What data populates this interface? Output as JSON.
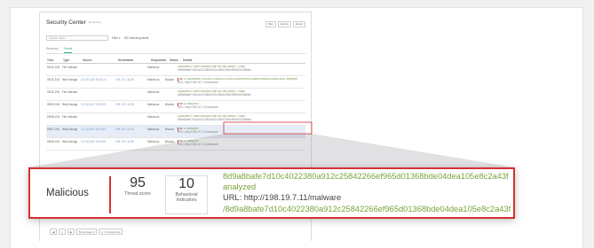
{
  "app": {
    "title": "Security Center",
    "title_suffix": "(for devices)",
    "header_buttons": [
      {
        "label": "Filter"
      },
      {
        "label": "Dismiss"
      },
      {
        "label": "Export"
      }
    ],
    "search_placeholder": "Search alerts",
    "filter_label": "Filter ▾",
    "filter_value": "150 matching alerts",
    "tabs": [
      {
        "label": "Summary"
      },
      {
        "label": "Events"
      }
    ],
    "columns": [
      "Time",
      "Type",
      "Source",
      "Destination",
      "Disposition",
      "Status",
      "Details"
    ],
    "rows": [
      {
        "time": "09:12 2/16/21",
        "type": "File Indicators 5 Support",
        "source": "",
        "destination": "",
        "disposition": "Malicious",
        "status": "",
        "detail_green": "Disposition: Hash indicator with file disk action 1 Hash",
        "detail_gray": "8d9a8bafe7d10c4022380a912c25842266ef965d01368bde"
      },
      {
        "time": "09:11 2/16/21",
        "type": "Web Navigation",
        "source": "10.133.187.90:3121",
        "destination": "199.19.7.11:80",
        "disposition": "Malicious",
        "status": "Blocked",
        "score": "95",
        "indicators": "10",
        "detail_green": "8d9a8bafe7d10c4022380a912c25842266ef965d01368bde04dea105e8c2a43f analyzed",
        "detail_gray": "URL: http://198.19.7.11/malware"
      },
      {
        "time": "09:10 2/16/21",
        "type": "File Indicators 5 Support",
        "source": "",
        "destination": "",
        "disposition": "Malicious",
        "status": "",
        "detail_green": "Disposition: Hash indicator with file disk action 1 Hash",
        "detail_gray": "8d9a8bafe7d10c4022380a912c25842266ef965d01368bde"
      },
      {
        "time": "09:09 2/16/21",
        "type": "Web Navigation",
        "source": "10.133.187.90:3120",
        "destination": "199.19.7.11:80",
        "disposition": "Malicious",
        "status": "Blocked",
        "score": "95",
        "indicators": "10",
        "detail_green": "analyzed",
        "detail_gray": "URL: http://198.19.7.11/malware"
      },
      {
        "time": "09:08 2/16/21",
        "type": "File Indicators 5 Support",
        "source": "",
        "destination": "",
        "disposition": "Malicious",
        "status": "",
        "detail_green": "Disposition: Hash indicator with file disk action 1 Hash",
        "detail_gray": "8d9a8bafe7d10c4022380a912c25842266ef965d01368bde"
      },
      {
        "time": "09:07 2/16/21",
        "type": "Web Navigation",
        "source": "10.133.187.90:3119",
        "destination": "199.19.7.11:80",
        "disposition": "Malicious",
        "status": "Blocked",
        "score": "94",
        "indicators": "11",
        "detail_green": "analyzed",
        "detail_gray": "URL: http://198.19.7.11/malware"
      },
      {
        "time": "09:06 2/16/21",
        "type": "Web Navigation",
        "source": "10.133.187.90:3118",
        "destination": "199.19.7.11:80",
        "disposition": "Malicious",
        "status": "Blocked",
        "score": "95",
        "indicators": "10",
        "detail_green": "analyzed",
        "detail_gray": "URL: http://198.19.7.11/malware"
      }
    ],
    "pager": [
      {
        "label": "◀"
      },
      {
        "label": "1"
      },
      {
        "label": "▶"
      },
      {
        "label": "50 per page ▾"
      },
      {
        "label": "1-7 of many rows"
      }
    ]
  },
  "callout": {
    "disposition": "Malicious",
    "threat_score": "95",
    "threat_score_label": "Threat score",
    "indicators": "10",
    "indicators_label": "Behavioral Indicators",
    "hash": "8d9a8bafe7d10c4022380a912c25842266ef965d01368bde04dea105e8c2a43f",
    "status": "analyzed",
    "url_line": "URL: http://198.19.7.11/malware",
    "path_line": "/8d9a8bafe7d10c4022380a912c25842266ef965d01368bde04dea105e8c2a43f"
  },
  "colors": {
    "accent": "#d23234",
    "detail_green": "#7aa33a",
    "selected_row": "#e6edf6"
  }
}
